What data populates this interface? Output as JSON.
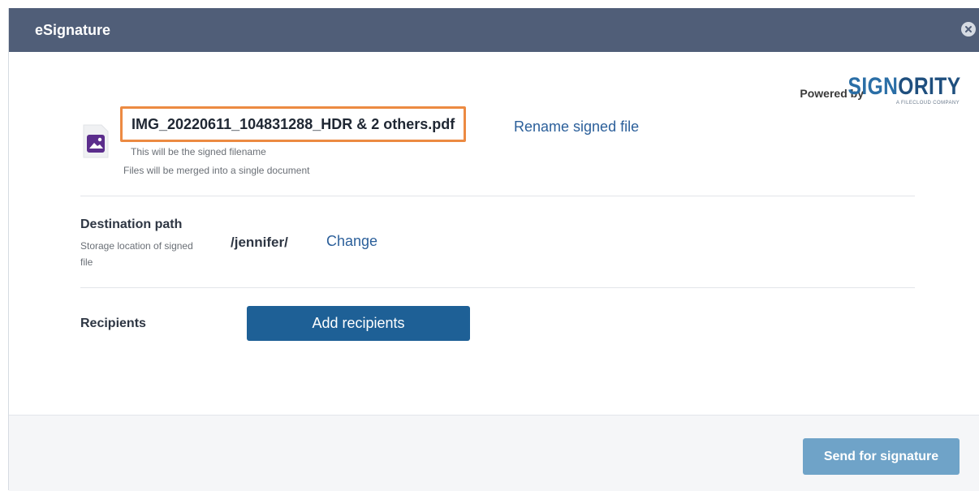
{
  "dialog": {
    "title": "eSignature",
    "close_icon": "close-icon"
  },
  "branding": {
    "powered_by": "Powered by",
    "brand_part1": "SIGN",
    "brand_part2": "ORITY",
    "brand_tagline": "A FILECLOUD COMPANY",
    "brand_colors": [
      "#2a6ea6",
      "#1f4f7e"
    ]
  },
  "file": {
    "icon": "image-file-icon",
    "name": "IMG_20220611_104831288_HDR & 2 others.pdf",
    "rename_link": "Rename signed file",
    "hint_filename": "This will be the signed filename",
    "hint_merge": "Files will be merged into a single document",
    "highlight_color": "#ec8a42"
  },
  "destination": {
    "label": "Destination path",
    "hint": "Storage location of signed file",
    "path": "/jennifer/",
    "change_link": "Change"
  },
  "recipients": {
    "label": "Recipients",
    "add_button": "Add recipients"
  },
  "footer": {
    "send_button": "Send for signature"
  },
  "colors": {
    "titlebar": "#505e78",
    "primary_button": "#1e6096",
    "disabled_button": "#6fa3c8",
    "link": "#2b5f9a"
  }
}
